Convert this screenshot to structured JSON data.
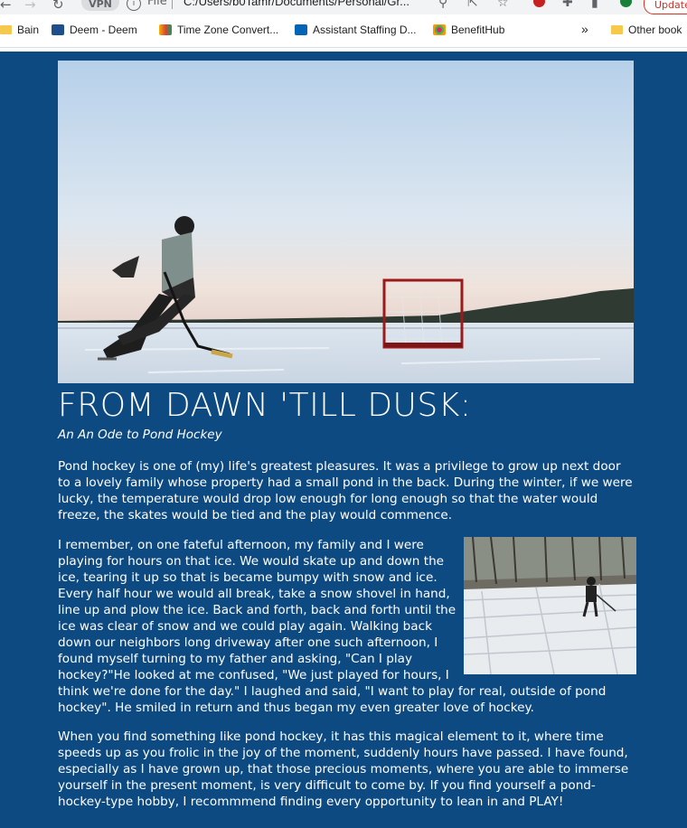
{
  "browser": {
    "url": "C:/Users/b0Tamr/Documents/Personal/Gr...",
    "protocol": "File",
    "update_label": "Update",
    "bookmarks": [
      {
        "label": "Bain",
        "icon": "folder-icon"
      },
      {
        "label": "Deem - Deem",
        "icon": "deem-icon"
      },
      {
        "label": "Time Zone Convert...",
        "icon": "timezone-icon"
      },
      {
        "label": "Assistant Staffing D...",
        "icon": "sharepoint-icon"
      },
      {
        "label": "BenefitHub",
        "icon": "benefithub-icon"
      }
    ],
    "overflow_label": "»",
    "other_bookmarks": "Other book"
  },
  "article": {
    "title": "FROM DAWN 'TILL DUSK:",
    "subtitle": "An An Ode to Pond Hockey",
    "paragraphs": [
      "Pond hockey is one of (my) life's greatest pleasures. It was a privilege to grow up next door to a lovely family whose property had a small pond in the back. During the winter, if we were lucky, the temperature would drop low enough for long enough so that the water would freeze, the skates would be tied and the play would commence.",
      "I remember, on one fateful afternoon, my family and I were playing for hours on that ice. We would skate up and down the ice, tearing it up so that is became bumpy with snow and ice. Every half hour we would all break, take a snow shovel in hand, line up and plow the ice. Back and forth, back and forth until the ice was clear of snow and we could play again. Walking back down our neighbors long driveway after one such afternoon, I found myself turning to my father and asking, \"Can I play hockey?\"He looked at me confused, \"We just played for hours, I think we're done for the day.\" I laughed and said, \"I want to play for real, outside of pond hockey\". He smiled in return and thus began my even greater love of hockey.",
      "When you find something like pond hockey, it has this magical element to it, where time speeds up as you frolic in the joy of the moment, suddenly hours have passed. I have found, especially as I have grown up, that those precious moments, where you are able to immerse yourself in the present moment, is very difficult to come by. If you find yourself a pond-hockey-type hobby, I recommmend finding every opportunity to lean in and PLAY!"
    ]
  },
  "colors": {
    "page_bg": "#0d4a82",
    "text": "#ffffff"
  }
}
